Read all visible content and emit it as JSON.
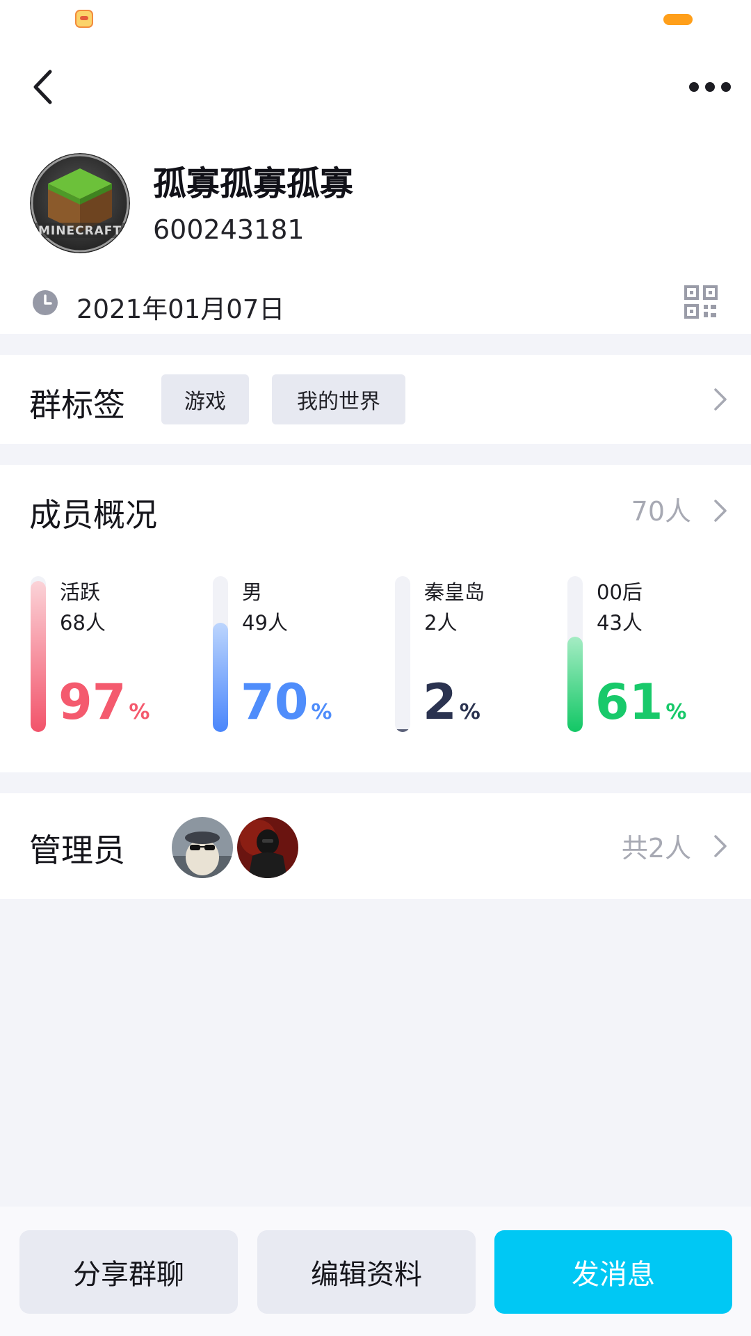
{
  "colors": {
    "active": "#f45a6e",
    "male": "#4f8dfb",
    "region": "#2b3350",
    "age": "#18c96a",
    "primary_button": "#00c8f4"
  },
  "status_bar": {
    "left_icon": "app-notification-icon",
    "right_indicator": "battery-indicator"
  },
  "header": {
    "back_icon": "chevron-left-icon",
    "more_icon": "more-dots-icon"
  },
  "group": {
    "name": "孤寡孤寡孤寡",
    "id": "600243181",
    "avatar_logo_text": "MINECRAFT",
    "created_date": "2021年01月07日",
    "date_icon": "clock-icon",
    "qr_icon": "qr-code-icon"
  },
  "tags_section": {
    "title": "群标签",
    "tags": [
      "游戏",
      "我的世界"
    ]
  },
  "members_section": {
    "title": "成员概况",
    "total": "70人",
    "stats": [
      {
        "label": "活跃",
        "count": "68人",
        "percent": 97,
        "unit": "%"
      },
      {
        "label": "男",
        "count": "49人",
        "percent": 70,
        "unit": "%"
      },
      {
        "label": "秦皇岛",
        "count": "2人",
        "percent": 2,
        "unit": "%"
      },
      {
        "label": "00后",
        "count": "43人",
        "percent": 61,
        "unit": "%"
      }
    ]
  },
  "admins_section": {
    "title": "管理员",
    "total": "共2人",
    "avatars": [
      "admin-avatar-sheep",
      "admin-avatar-soldier"
    ]
  },
  "bottom_bar": {
    "share": "分享群聊",
    "edit": "编辑资料",
    "send": "发消息"
  }
}
